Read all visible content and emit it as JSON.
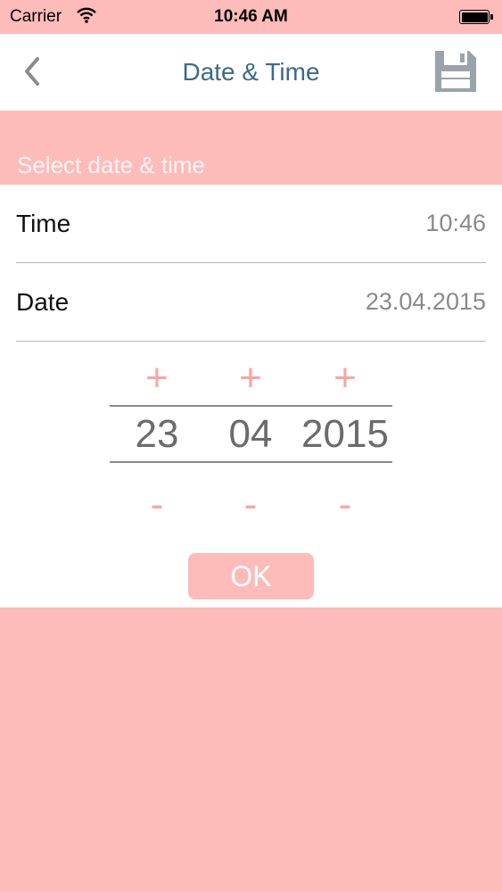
{
  "status_bar": {
    "carrier": "Carrier",
    "time": "10:46 AM"
  },
  "nav": {
    "title": "Date & Time",
    "back_icon": "chevron-left-icon",
    "save_icon": "floppy-disk-icon"
  },
  "section": {
    "header": "Select date & time"
  },
  "fields": {
    "time_label": "Time",
    "time_value": "10:46",
    "date_label": "Date",
    "date_value": "23.04.2015"
  },
  "picker": {
    "increment_label": "+",
    "decrement_label": "-",
    "day": "23",
    "month": "04",
    "year": "2015"
  },
  "actions": {
    "ok_label": "OK"
  },
  "colors": {
    "accent_pink": "#fdbbba",
    "title_blue": "#3b6a86",
    "stepper_pink": "#f7a7a6"
  }
}
